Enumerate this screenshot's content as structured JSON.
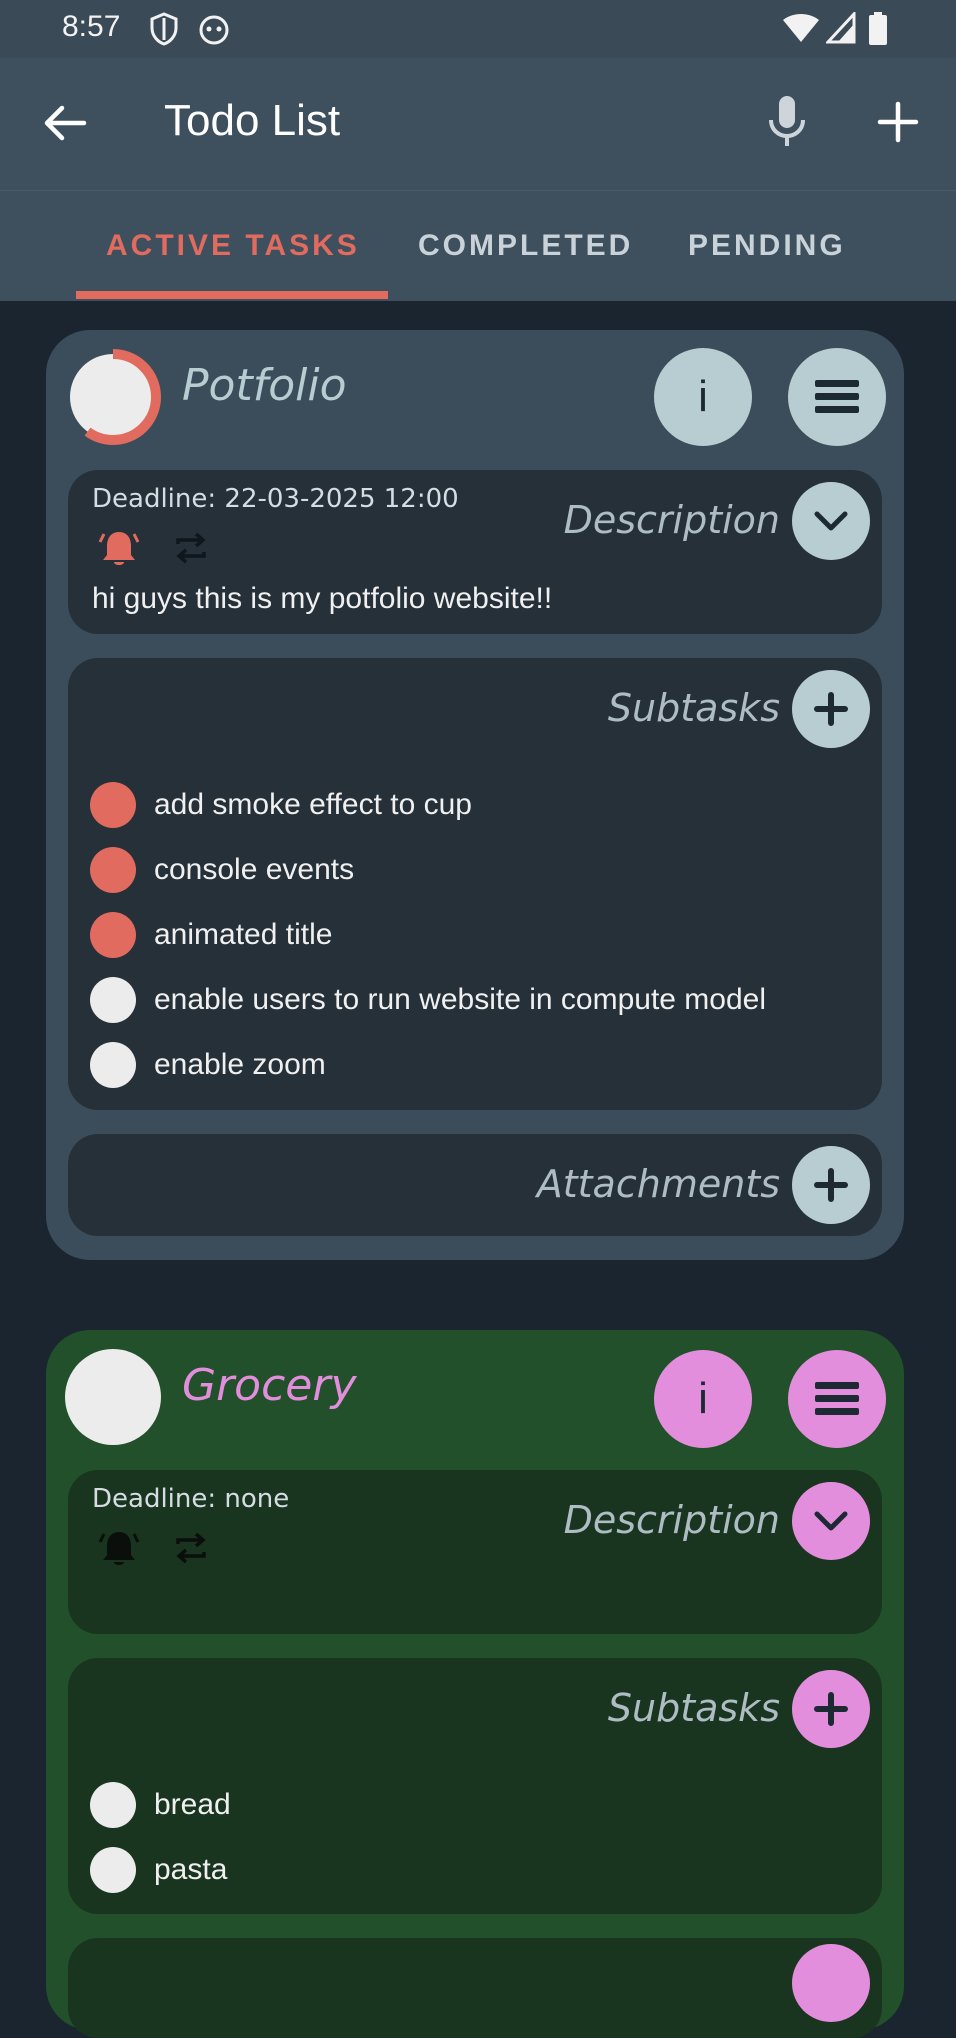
{
  "status_bar": {
    "time": "8:57"
  },
  "app_bar": {
    "title": "Todo List"
  },
  "tabs": [
    {
      "label": "ACTIVE TASKS",
      "active": true
    },
    {
      "label": "COMPLETED",
      "active": false
    },
    {
      "label": "PENDING",
      "active": false
    }
  ],
  "tasks": [
    {
      "title": "Potfolio",
      "color": "#3b4d5a",
      "accent": "#b7cdd1",
      "progress": 0.6,
      "deadline": "Deadline: 22-03-2025 12:00",
      "description_label": "Description",
      "description": "hi guys this is my potfolio website!!",
      "subtasks_label": "Subtasks",
      "subtasks": [
        {
          "label": "add smoke effect to cup",
          "done": true
        },
        {
          "label": "console events",
          "done": true
        },
        {
          "label": "animated title",
          "done": true
        },
        {
          "label": "enable users to run website in compute model",
          "done": false
        },
        {
          "label": "enable zoom",
          "done": false
        }
      ],
      "attachments_label": "Attachments"
    },
    {
      "title": "Grocery",
      "color": "#22502a",
      "accent": "#e28edd",
      "progress": 0,
      "deadline": "Deadline: none",
      "description_label": "Description",
      "description": "",
      "subtasks_label": "Subtasks",
      "subtasks": [
        {
          "label": "bread",
          "done": false
        },
        {
          "label": "pasta",
          "done": false
        }
      ]
    }
  ],
  "colors": {
    "accent_red": "#e06b5e",
    "background": "#1b2530",
    "appbar": "#3e505d"
  }
}
